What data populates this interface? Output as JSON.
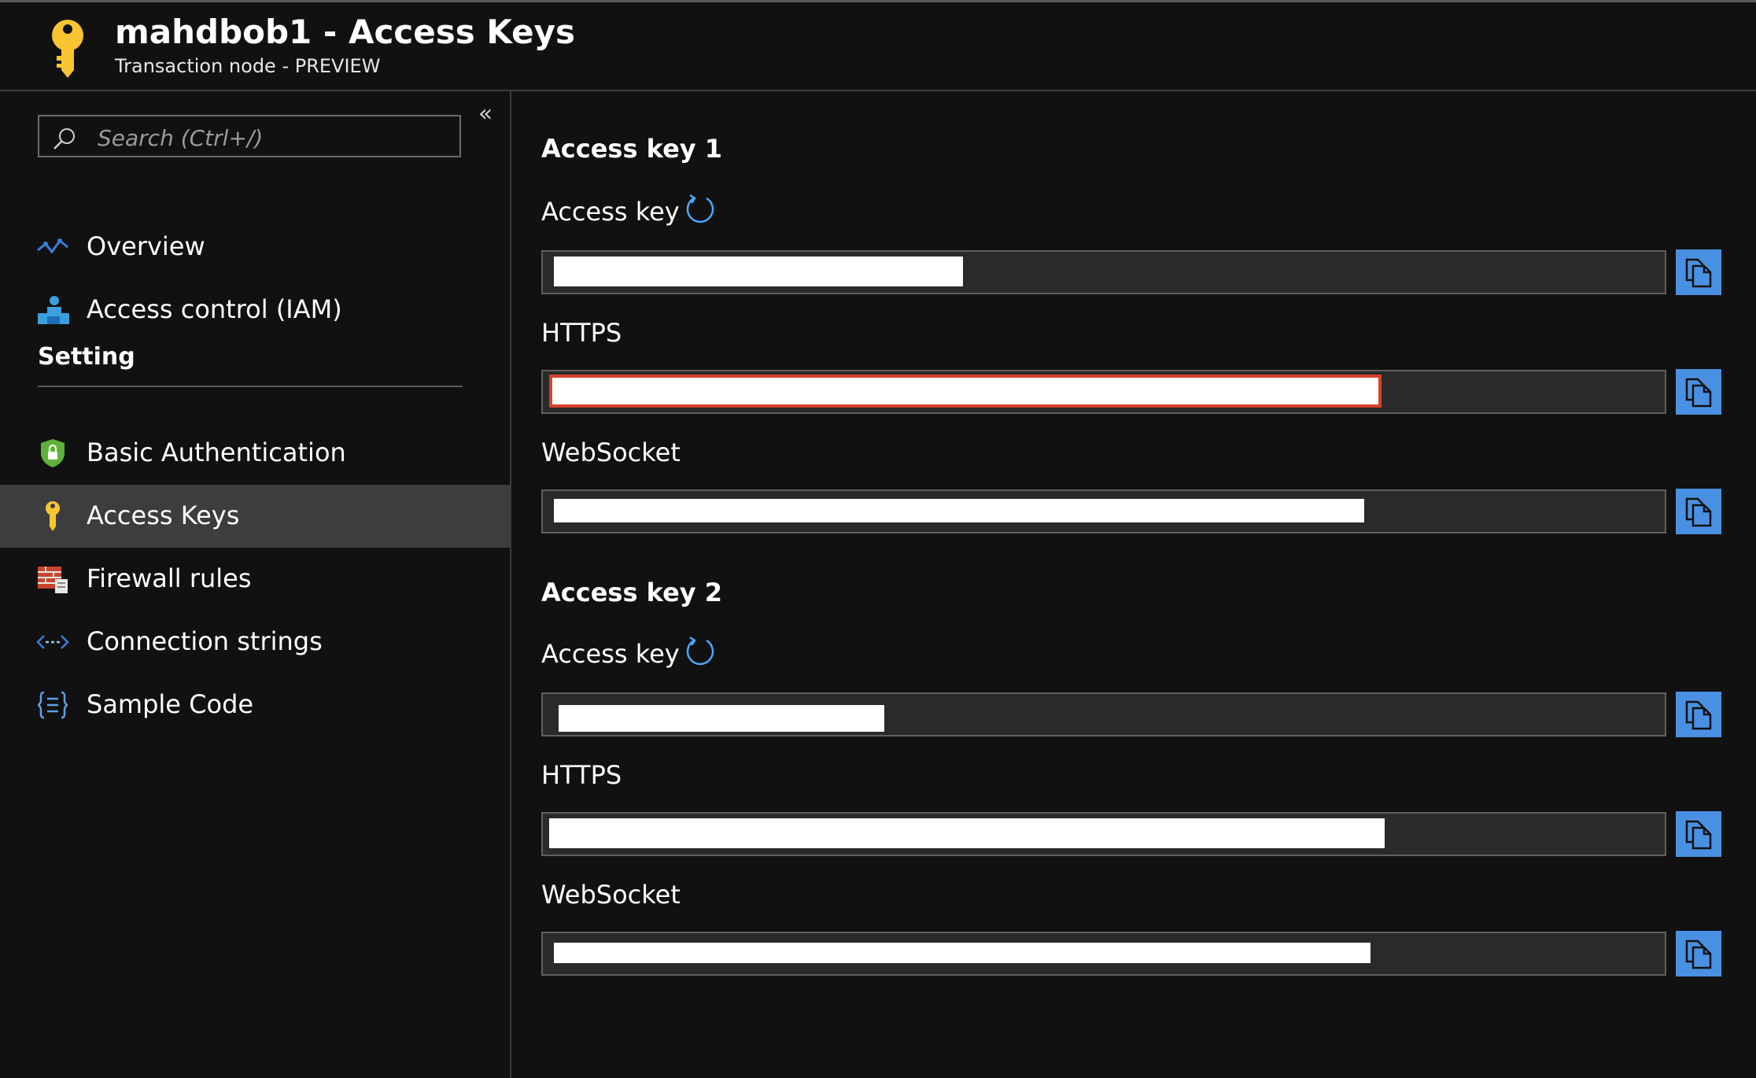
{
  "header": {
    "title": "mahdbob1 - Access Keys",
    "subtitle": "Transaction node - PREVIEW",
    "icon": "key-icon",
    "icon_color": "#f7c531"
  },
  "sidebar": {
    "search_placeholder": "Search (Ctrl+/)",
    "collapse_icon": "double-chevron-left-icon",
    "items_top": [
      {
        "label": "Overview",
        "icon": "overview-icon"
      },
      {
        "label": "Access control (IAM)",
        "icon": "iam-icon"
      }
    ],
    "section_title": "Setting",
    "items_setting": [
      {
        "label": "Basic Authentication",
        "icon": "shield-lock-icon"
      },
      {
        "label": "Access Keys",
        "icon": "key-icon",
        "active": true
      },
      {
        "label": "Firewall rules",
        "icon": "firewall-icon"
      },
      {
        "label": "Connection strings",
        "icon": "connection-icon"
      },
      {
        "label": "Sample Code",
        "icon": "code-braces-icon"
      }
    ],
    "active_color": "#3d3d3d"
  },
  "main": {
    "groups": [
      {
        "title": "Access key 1",
        "fields": [
          {
            "label": "Access key",
            "value": "",
            "regenerate": true
          },
          {
            "label": "HTTPS",
            "value": "",
            "focused": true
          },
          {
            "label": "WebSocket",
            "value": ""
          }
        ]
      },
      {
        "title": "Access key 2",
        "fields": [
          {
            "label": "Access key",
            "value": "",
            "regenerate": true
          },
          {
            "label": "HTTPS",
            "value": ""
          },
          {
            "label": "WebSocket",
            "value": ""
          }
        ]
      }
    ],
    "copy_icon": "copy-icon",
    "copy_button_color": "#4a90e2",
    "focus_color": "#d8412a"
  }
}
